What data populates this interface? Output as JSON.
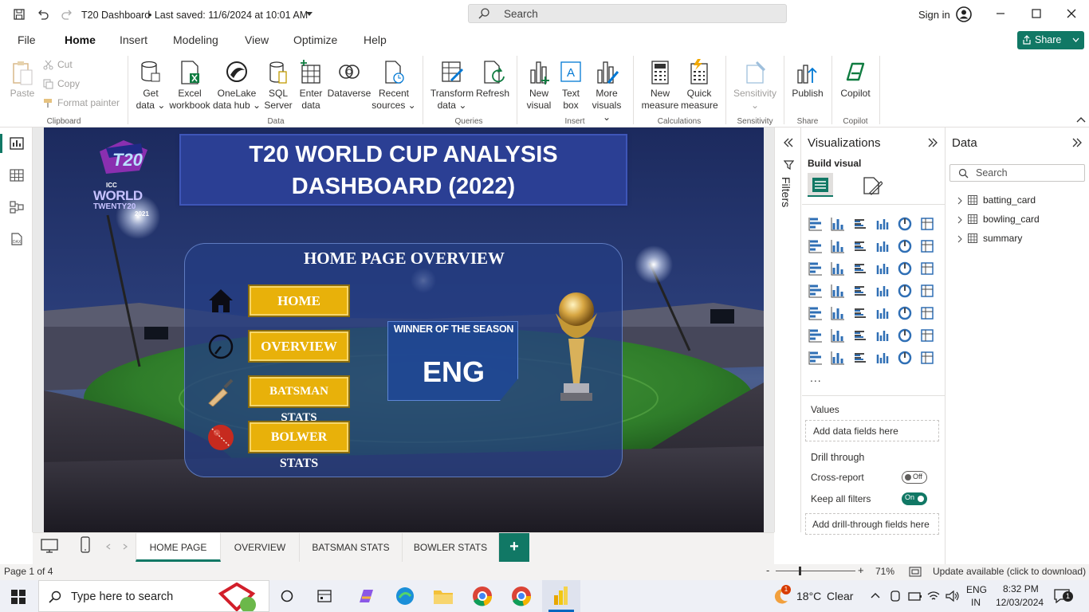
{
  "titlebar": {
    "doc_title": "T20 Dashboard",
    "saved_status": "• Last saved: 11/6/2024 at 10:01 AM",
    "search_placeholder": "Search",
    "sign_in": "Sign in"
  },
  "menu": {
    "items": [
      "File",
      "Home",
      "Insert",
      "Modeling",
      "View",
      "Optimize",
      "Help"
    ],
    "active": "Home",
    "share_label": "Share"
  },
  "ribbon": {
    "clipboard": {
      "paste": "Paste",
      "cut": "Cut",
      "copy": "Copy",
      "format_painter": "Format painter",
      "group": "Clipboard"
    },
    "data": {
      "get_data": [
        "Get",
        "data ⌄"
      ],
      "excel": [
        "Excel",
        "workbook"
      ],
      "onelake": [
        "OneLake",
        "data hub ⌄"
      ],
      "sql": [
        "SQL",
        "Server"
      ],
      "enter": [
        "Enter",
        "data"
      ],
      "dataverse": [
        "Dataverse",
        ""
      ],
      "recent": [
        "Recent",
        "sources ⌄"
      ],
      "group": "Data"
    },
    "queries": {
      "transform": [
        "Transform",
        "data ⌄"
      ],
      "refresh": [
        "Refresh",
        ""
      ],
      "group": "Queries"
    },
    "insert": {
      "new_visual": [
        "New",
        "visual"
      ],
      "text_box": [
        "Text",
        "box"
      ],
      "more_visuals": [
        "More",
        "visuals ⌄"
      ],
      "group": "Insert"
    },
    "calculations": {
      "new_measure": [
        "New",
        "measure"
      ],
      "quick_measure": [
        "Quick",
        "measure"
      ],
      "group": "Calculations"
    },
    "sensitivity": {
      "label": [
        "Sensitivity",
        "⌄"
      ],
      "group": "Sensitivity"
    },
    "share": {
      "publish": "Publish",
      "group": "Share"
    },
    "copilot": {
      "label": "Copilot",
      "group": "Copilot"
    }
  },
  "report": {
    "logo": {
      "line1": "ICC",
      "line2": "WORLD",
      "line3": "TWENTY20",
      "line4": "2021"
    },
    "title_line1": "T20 WORLD CUP ANALYSIS",
    "title_line2": "DASHBOARD (2022)",
    "panel_heading": "HOME PAGE OVERVIEW",
    "nav_buttons": [
      "HOME",
      "OVERVIEW",
      "BATSMAN STATS",
      "BOLWER STATS"
    ],
    "winner_label": "WINNER OF THE SEASON",
    "winner_value": "ENG"
  },
  "filters_label": "Filters",
  "visualizations": {
    "title": "Visualizations",
    "build_visual": "Build visual",
    "more": "...",
    "values_label": "Values",
    "values_placeholder": "Add data fields here",
    "drill_through": "Drill through",
    "cross_report": "Cross-report",
    "cross_report_state": "Off",
    "keep_filters": "Keep all filters",
    "keep_filters_state": "On",
    "drill_placeholder": "Add drill-through fields here"
  },
  "data_pane": {
    "title": "Data",
    "search_placeholder": "Search",
    "tables": [
      "batting_card",
      "bowling_card",
      "summary"
    ]
  },
  "pages": {
    "tabs": [
      "HOME PAGE",
      "OVERVIEW",
      "BATSMAN STATS",
      "BOWLER STATS"
    ],
    "active": "HOME PAGE",
    "add": "+"
  },
  "status": {
    "page": "Page 1 of 4",
    "zoom": "71%",
    "update": "Update available (click to download)"
  },
  "taskbar": {
    "search_placeholder": "Type here to search",
    "weather_temp": "18°C",
    "weather_desc": "Clear",
    "weather_badge": "1",
    "lang1": "ENG",
    "lang2": "IN",
    "time": "8:32 PM",
    "date": "12/03/2024",
    "notifications": "1"
  },
  "colors": {
    "accent": "#117865",
    "button_yellow": "#e8b10a",
    "title_banner": "#2b3f94",
    "panel_blue": "#2c4a8c"
  }
}
